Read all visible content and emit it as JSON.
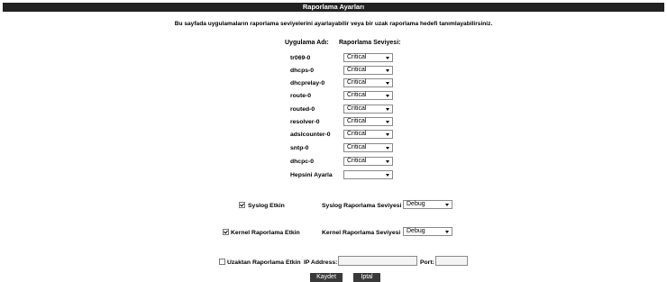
{
  "title": "Raporlama Ayarları",
  "description": "Bu sayfada uygulamaların raporlama seviyelerini ayarlayabilir veya bir uzak raporlama hedefi tanımlayabilirsiniz.",
  "table": {
    "col_app": "Uygulama Adı:",
    "col_level": "Raporlama Seviyesi:",
    "rows": [
      {
        "name": "tr069-0",
        "level": "Critical"
      },
      {
        "name": "dhcps-0",
        "level": "Critical"
      },
      {
        "name": "dhcprelay-0",
        "level": "Critical"
      },
      {
        "name": "route-0",
        "level": "Critical"
      },
      {
        "name": "routed-0",
        "level": "Critical"
      },
      {
        "name": "resolver-0",
        "level": "Critical"
      },
      {
        "name": "adslcounter-0",
        "level": "Critical"
      },
      {
        "name": "sntp-0",
        "level": "Critical"
      },
      {
        "name": "dhcpc-0",
        "level": "Critical"
      }
    ],
    "set_all_label": "Hepsini Ayarla",
    "set_all_value": ""
  },
  "syslog": {
    "label": "Syslog Etkin",
    "checked": true,
    "level_label": "Syslog Raporlama Seviyesi",
    "level_value": "Debug"
  },
  "kernel": {
    "label": "Kernel Raporlama Etkin",
    "checked": true,
    "level_label": "Kernel Raporlama Seviyesi",
    "level_value": "Debug"
  },
  "remote": {
    "label": "Uzaktan Raporlama Etkin",
    "checked": false,
    "ip_label": "IP Address:",
    "ip_value": "",
    "port_label": "Port:",
    "port_value": ""
  },
  "buttons": {
    "save": "Kaydet",
    "cancel": "İptal"
  },
  "colors": {
    "titlebar_bg": "#222222",
    "button_bg": "#3a3a3a"
  },
  "icons": {
    "dropdown": "chevron-down-icon",
    "checkbox": "checkbox-icon"
  }
}
